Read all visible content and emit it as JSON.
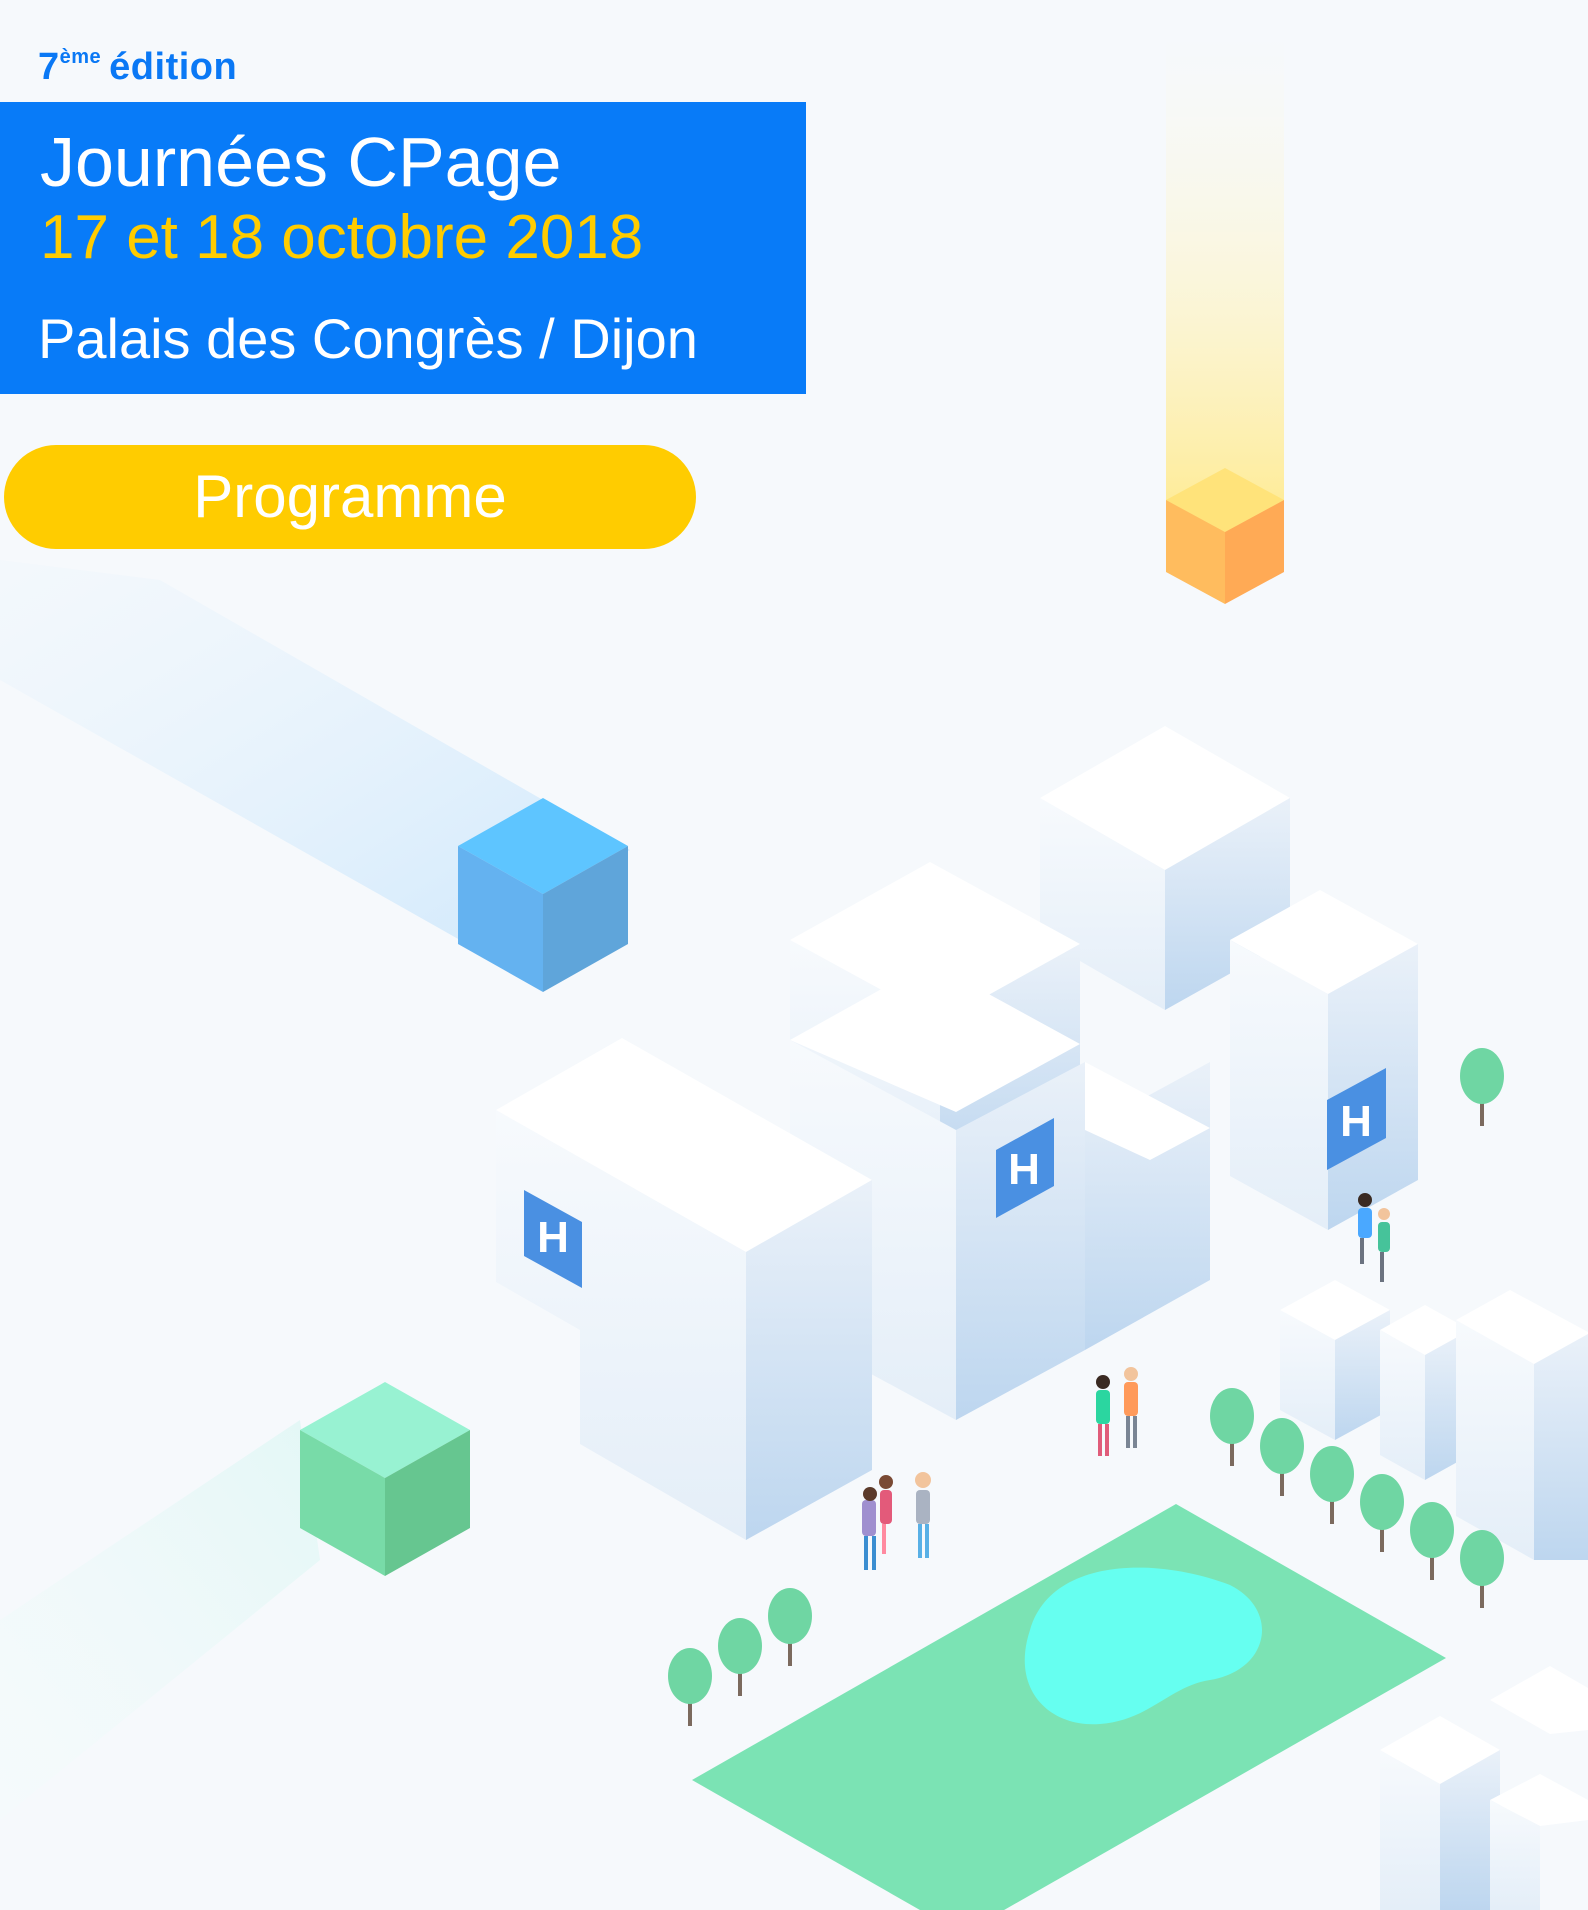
{
  "header": {
    "edition_number": "7",
    "edition_suffix": "ème",
    "edition_word": "édition",
    "event_title": "Journées CPage",
    "event_dates": "17 et 18 octobre 2018",
    "event_place": "Palais des Congrès / Dijon"
  },
  "actions": {
    "programme_label": "Programme"
  },
  "illustration": {
    "building_sign_letter": "H",
    "colors": {
      "blue_accent": "#087bf8",
      "yellow_accent": "#ffcc00",
      "park_green": "#7be3b4",
      "pond_cyan": "#66fff0"
    }
  }
}
